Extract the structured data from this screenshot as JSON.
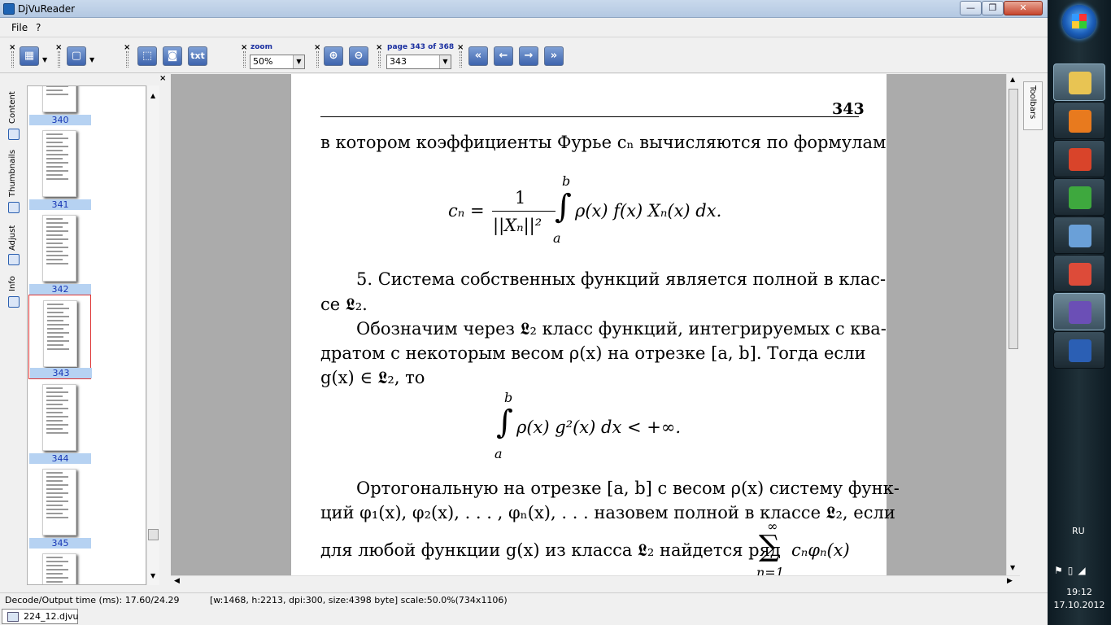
{
  "window": {
    "title": "DjVuReader",
    "min_glyph": "—",
    "max_glyph": "❐",
    "close_glyph": "✕"
  },
  "menu": {
    "file": "File",
    "help": "?"
  },
  "toolbar": {
    "close_glyph": "×",
    "zoom_label": "zoom",
    "zoom_value": "50%",
    "page_label": "page 343 of 368",
    "page_value": "343",
    "txt_label": "txt",
    "zoom_in_glyph": "⊕",
    "zoom_out_glyph": "⊖",
    "first_glyph": "«",
    "prev_glyph": "←",
    "next_glyph": "→",
    "last_glyph": "»"
  },
  "side_tabs": [
    "Content",
    "Thumbnails",
    "Adjust",
    "Info"
  ],
  "thumbnails": [
    {
      "label": "340",
      "selected": false
    },
    {
      "label": "341",
      "selected": false
    },
    {
      "label": "342",
      "selected": false
    },
    {
      "label": "343",
      "selected": true
    },
    {
      "label": "344",
      "selected": false
    },
    {
      "label": "345",
      "selected": false
    },
    {
      "label": "",
      "selected": false
    }
  ],
  "doc": {
    "page_number": "343",
    "line1": "в котором коэффициенты Фурье cₙ вычисляются по формулам",
    "formula1_lhs": "cₙ =",
    "formula1_num": "1",
    "formula1_den": "||Xₙ||²",
    "formula1_int_top": "b",
    "formula1_int_bot": "a",
    "formula1_rhs": "ρ(x) f(x) Xₙ(x) dx.",
    "para5_line1": "5. Система собственных функций является полной в клас-",
    "para5_line2": "се 𝕷₂.",
    "para6_line1": "Обозначим через 𝕷₂ класс функций, интегрируемых с ква-",
    "para6_line2": "дратом с некоторым весом ρ(x) на отрезке [a, b].  Тогда если",
    "para6_line3": "g(x) ∈ 𝕷₂, то",
    "formula2_int_top": "b",
    "formula2_int_bot": "a",
    "formula2_body": "ρ(x) g²(x) dx < +∞.",
    "para7_line1": "Ортогональную на отрезке [a, b] с весом ρ(x) систему функ-",
    "para7_line2": "ций φ₁(x), φ₂(x), . . . , φₙ(x), . . . назовем полной в классе 𝕷₂, если",
    "para7_line3": "для любой функции g(x) из класса 𝕷₂ найдется ряд",
    "sum_top": "∞",
    "sum_body": "cₙφₙ(x)",
    "sum_bot": "n=1"
  },
  "right_tab": "Toolbars",
  "status": {
    "decode": "Decode/Output time (ms): 17.60/24.29",
    "info": "[w:1468, h:2213, dpi:300, size:4398 byte] scale:50.0%(734x1106)"
  },
  "file_tab": "224_12.djvu",
  "taskbar": {
    "lang": "RU",
    "time": "19:12",
    "date": "17.10.2012",
    "apps": [
      {
        "name": "explorer",
        "color": "#e8c453",
        "active": true
      },
      {
        "name": "media-player",
        "color": "#e87a1e",
        "active": false
      },
      {
        "name": "paint",
        "color": "#d9442a",
        "active": false
      },
      {
        "name": "utorrent",
        "color": "#3ea83e",
        "active": false
      },
      {
        "name": "remote",
        "color": "#6aa0d8",
        "active": false
      },
      {
        "name": "chrome",
        "color": "#dd4b39",
        "active": false
      },
      {
        "name": "djvureader",
        "color": "#6b4fb6",
        "active": true
      },
      {
        "name": "word",
        "color": "#2b5fb4",
        "active": false
      }
    ]
  }
}
